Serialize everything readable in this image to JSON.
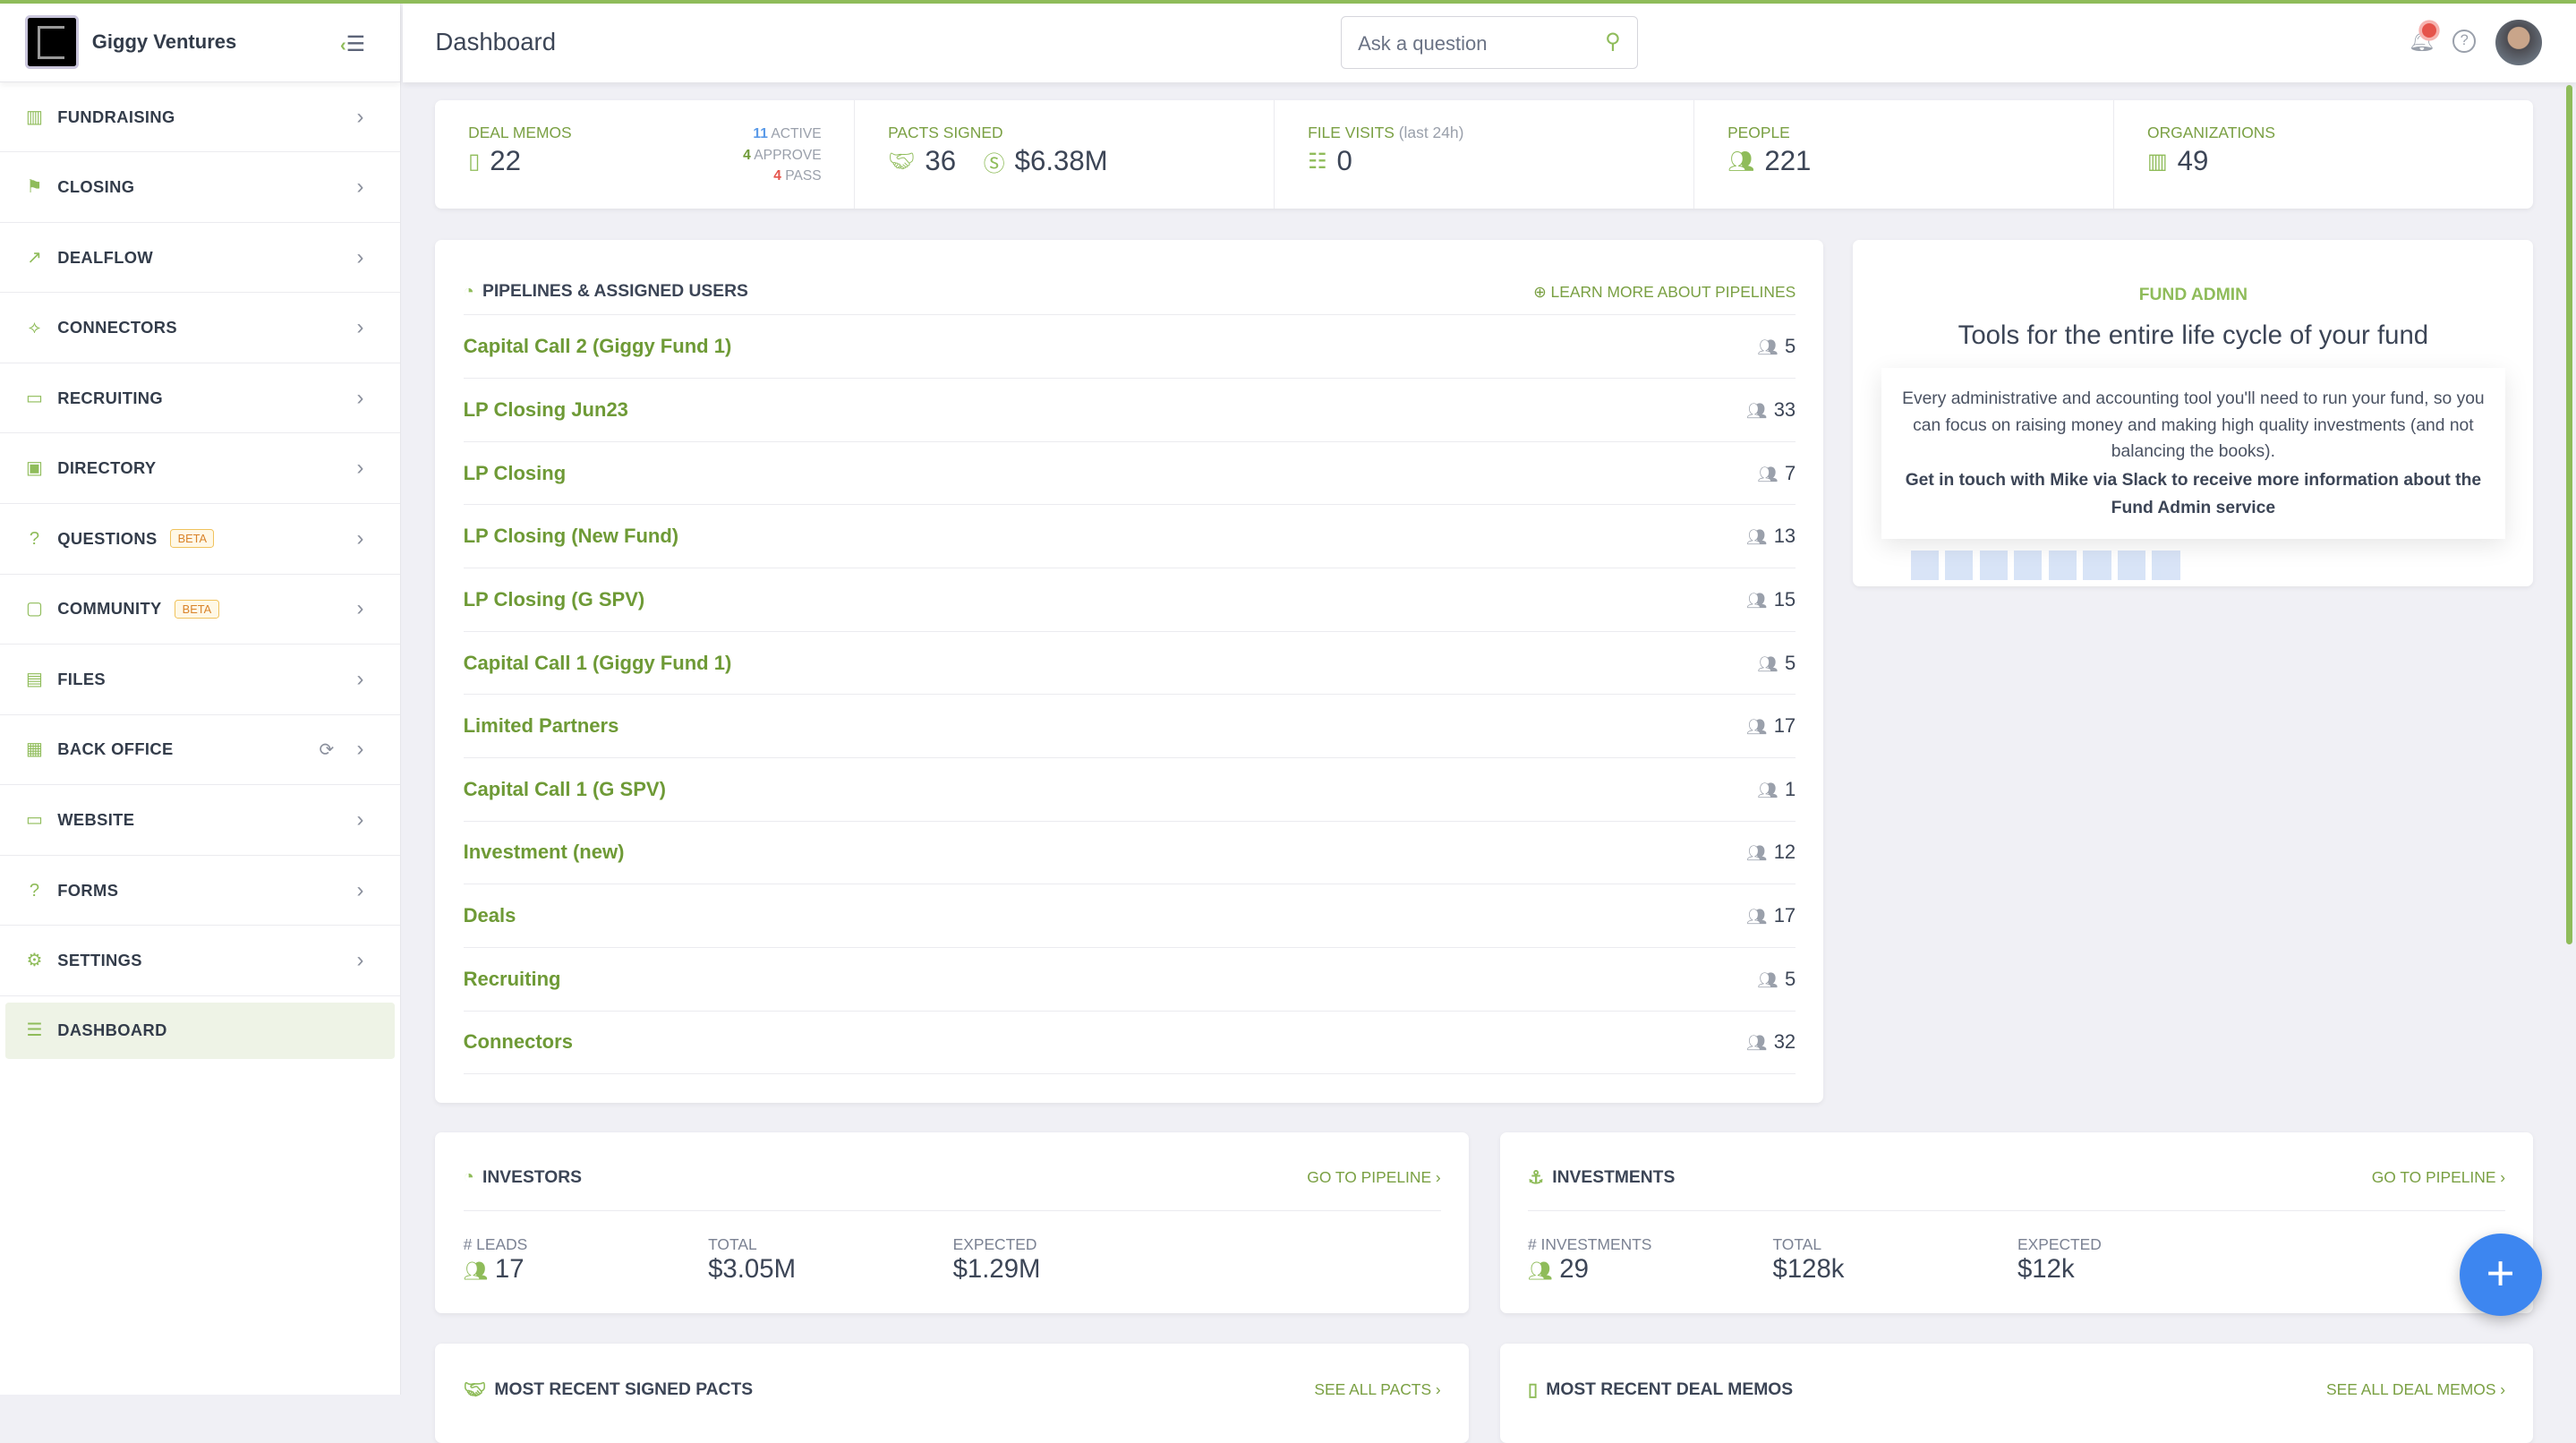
{
  "brand": {
    "name": "Giggy Ventures"
  },
  "sidebar": {
    "items": [
      {
        "label": "FUNDRAISING",
        "icon": "bar-chart-icon"
      },
      {
        "label": "CLOSING",
        "icon": "flag-icon"
      },
      {
        "label": "DEALFLOW",
        "icon": "trend-icon"
      },
      {
        "label": "CONNECTORS",
        "icon": "connector-icon"
      },
      {
        "label": "RECRUITING",
        "icon": "briefcase-icon"
      },
      {
        "label": "DIRECTORY",
        "icon": "contact-icon"
      },
      {
        "label": "QUESTIONS",
        "icon": "question-icon",
        "badge": "BETA"
      },
      {
        "label": "COMMUNITY",
        "icon": "chat-icon",
        "badge": "BETA"
      },
      {
        "label": "FILES",
        "icon": "files-icon"
      },
      {
        "label": "BACK OFFICE",
        "icon": "calculator-icon"
      },
      {
        "label": "WEBSITE",
        "icon": "browser-icon"
      },
      {
        "label": "FORMS",
        "icon": "form-icon"
      },
      {
        "label": "SETTINGS",
        "icon": "gear-icon"
      },
      {
        "label": "DASHBOARD",
        "icon": "dashboard-icon",
        "active": true
      }
    ]
  },
  "header": {
    "title": "Dashboard",
    "search_placeholder": "Ask a question"
  },
  "stats": {
    "deal_memos": {
      "label": "DEAL MEMOS",
      "value": "22",
      "active": "11",
      "active_label": "ACTIVE",
      "approve": "4",
      "approve_label": "APPROVE",
      "pass": "4",
      "pass_label": "PASS"
    },
    "pacts": {
      "label": "PACTS SIGNED",
      "value": "36",
      "amount": "$6.38M"
    },
    "file_visits": {
      "label": "FILE VISITS",
      "sub": "(last 24h)",
      "value": "0"
    },
    "people": {
      "label": "PEOPLE",
      "value": "221"
    },
    "orgs": {
      "label": "ORGANIZATIONS",
      "value": "49"
    }
  },
  "pipelines": {
    "title": "PIPELINES & ASSIGNED USERS",
    "link": "LEARN MORE ABOUT PIPELINES",
    "rows": [
      {
        "name": "Capital Call 2 (Giggy Fund 1)",
        "users": "5"
      },
      {
        "name": "LP Closing Jun23",
        "users": "33"
      },
      {
        "name": "LP Closing",
        "users": "7"
      },
      {
        "name": "LP Closing (New Fund)",
        "users": "13"
      },
      {
        "name": "LP Closing (G SPV)",
        "users": "15"
      },
      {
        "name": "Capital Call 1 (Giggy Fund 1)",
        "users": "5"
      },
      {
        "name": "Limited Partners",
        "users": "17"
      },
      {
        "name": "Capital Call 1 (G SPV)",
        "users": "1"
      },
      {
        "name": "Investment (new)",
        "users": "12"
      },
      {
        "name": "Deals",
        "users": "17"
      },
      {
        "name": "Recruiting",
        "users": "5"
      },
      {
        "name": "Connectors",
        "users": "32"
      }
    ]
  },
  "fund_admin": {
    "label": "FUND ADMIN",
    "title": "Tools for the entire life cycle of your fund",
    "body": "Every administrative and accounting tool you'll need to run your fund, so you can focus on raising money and making high quality investments (and not balancing the books).",
    "cta": "Get in touch with Mike via Slack to receive more information about the Fund Admin service"
  },
  "investors": {
    "title": "INVESTORS",
    "link": "GO TO PIPELINE ›",
    "leads_label": "# LEADS",
    "leads": "17",
    "total_label": "TOTAL",
    "total": "$3.05M",
    "expected_label": "EXPECTED",
    "expected": "$1.29M"
  },
  "investments": {
    "title": "INVESTMENTS",
    "link": "GO TO PIPELINE ›",
    "count_label": "# INVESTMENTS",
    "count": "29",
    "total_label": "TOTAL",
    "total": "$128k",
    "expected_label": "EXPECTED",
    "expected": "$12k"
  },
  "recent_pacts": {
    "title": "MOST RECENT SIGNED PACTS",
    "link": "SEE ALL PACTS ›"
  },
  "recent_memos": {
    "title": "MOST RECENT DEAL MEMOS",
    "link": "SEE ALL DEAL MEMOS ›"
  },
  "colors": {
    "accent": "#8fbc5a",
    "fab": "#3d86f0",
    "active_bg": "#eef3e6"
  }
}
